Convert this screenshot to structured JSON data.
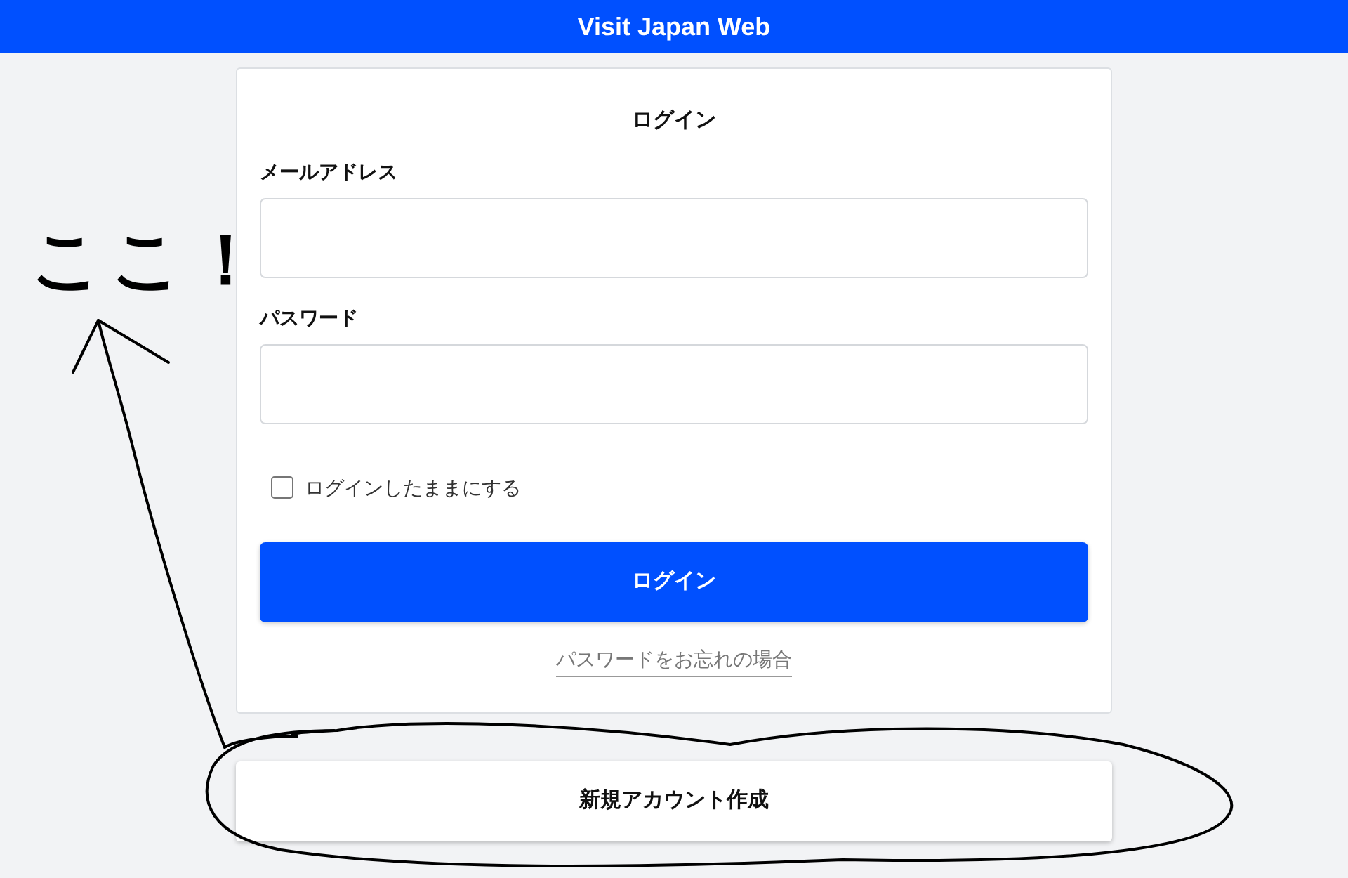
{
  "header": {
    "title": "Visit Japan Web"
  },
  "login_card": {
    "title": "ログイン",
    "fields": [
      {
        "label": "メールアドレス"
      },
      {
        "label": "パスワード"
      }
    ],
    "remember": {
      "label": "ログインしたままにする",
      "checked": false
    },
    "submit_button": "ログイン",
    "forgot_link": "パスワードをお忘れの場合"
  },
  "create_account_button": "新規アカウント作成",
  "annotation": {
    "text": "ここ！"
  }
}
